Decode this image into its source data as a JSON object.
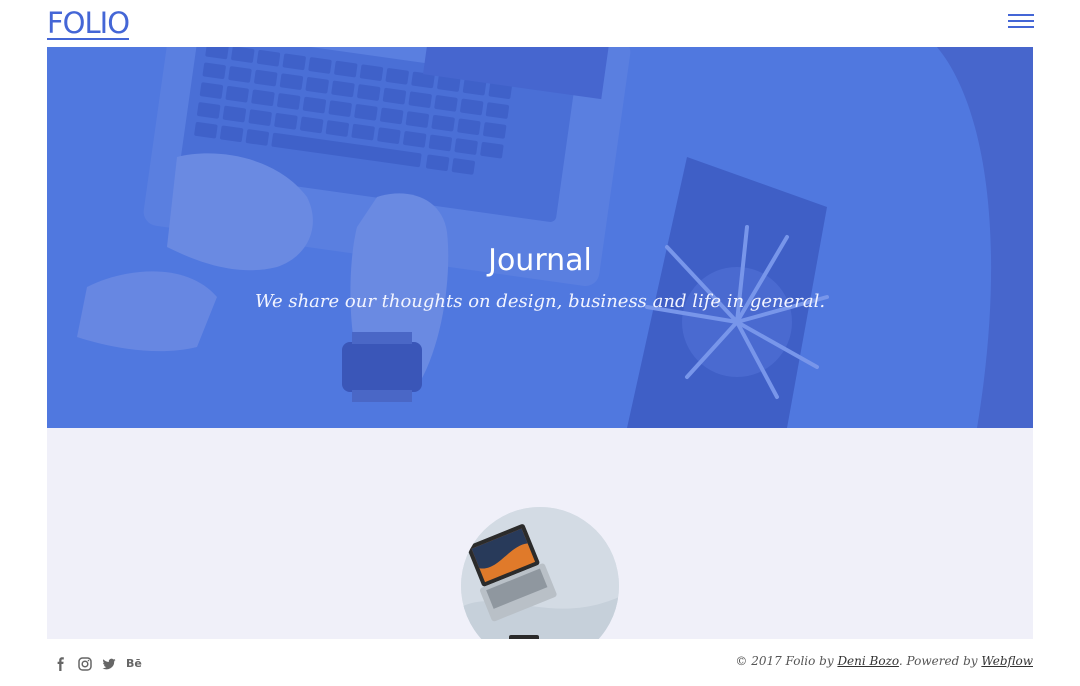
{
  "header": {
    "logo": "FOLIO",
    "menu_icon": "hamburger-icon"
  },
  "hero": {
    "title": "Journal",
    "subtitle": "We share our thoughts on design, business and life in general."
  },
  "footer": {
    "social_icons": [
      "facebook-icon",
      "instagram-icon",
      "twitter-icon",
      "behance-icon"
    ],
    "behance_label": "Bē",
    "copyright_prefix": "© 2017 Folio by ",
    "author_link": "Deni Bozo",
    "powered_prefix": ". Powered by ",
    "platform_link": "Webflow"
  },
  "colors": {
    "brand": "#4466d6",
    "hero_overlay": "#5078df",
    "content_bg": "#f0f0f9"
  }
}
